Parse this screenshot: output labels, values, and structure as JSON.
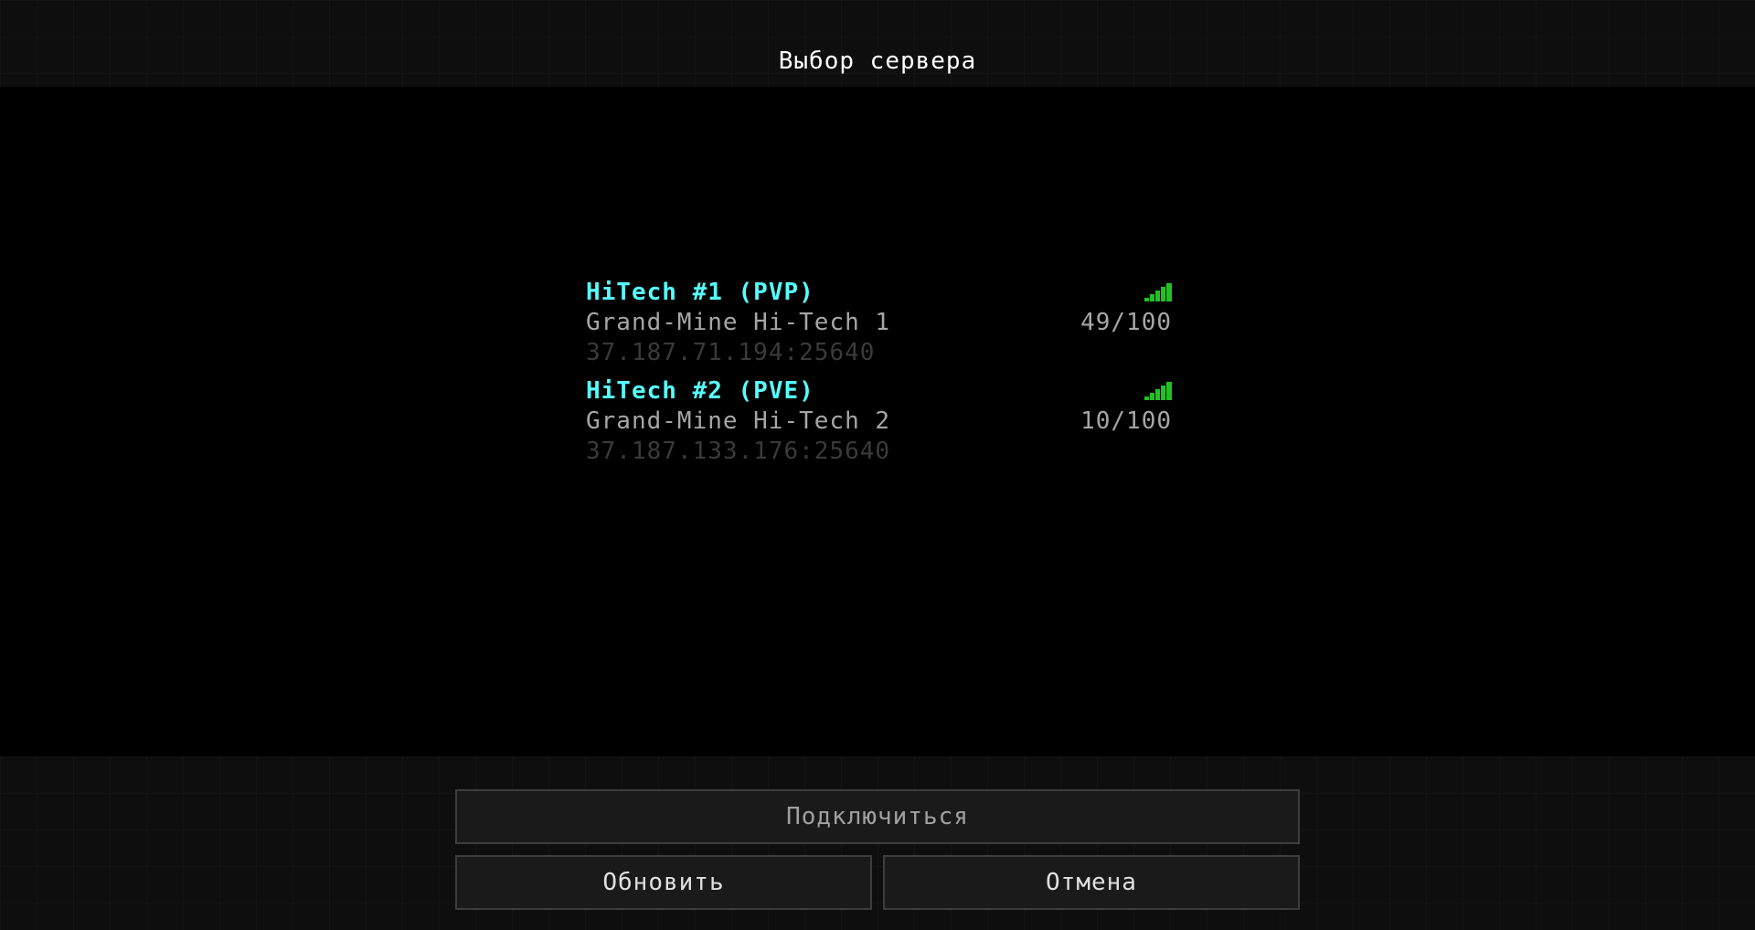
{
  "title": "Выбор сервера",
  "servers": [
    {
      "name": "HiTech #1 (PVP)",
      "motd": "Grand-Mine Hi-Tech 1",
      "address": "37.187.71.194:25640",
      "players": "49/100",
      "signal_icon": "signal-bars-icon",
      "signal_bars": 5
    },
    {
      "name": "HiTech #2 (PVE)",
      "motd": "Grand-Mine Hi-Tech 2",
      "address": "37.187.133.176:25640",
      "players": "10/100",
      "signal_icon": "signal-bars-icon",
      "signal_bars": 5
    }
  ],
  "buttons": {
    "connect": "Подключиться",
    "refresh": "Обновить",
    "cancel": "Отмена"
  },
  "colors": {
    "server_name": "#55ffff",
    "motd": "#a6a6a6",
    "address": "#3a3a3a",
    "signal": "#1fc21f",
    "title": "#ffffff"
  }
}
